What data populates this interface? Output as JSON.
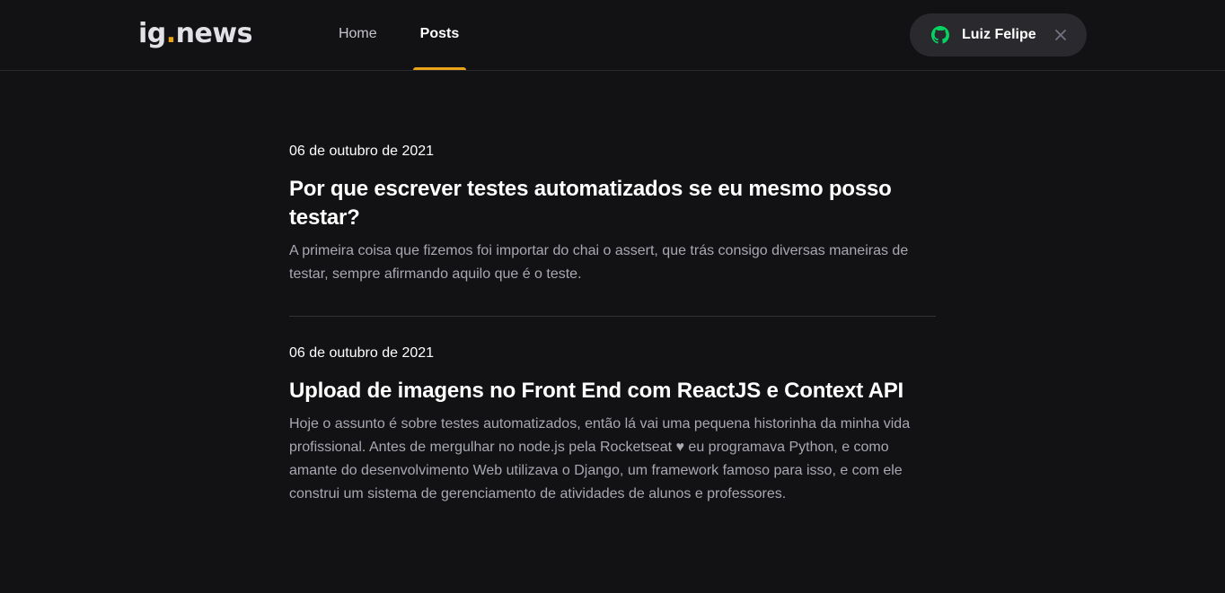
{
  "header": {
    "logo_main": "ig",
    "logo_dot": ".",
    "logo_rest": "news",
    "nav": [
      {
        "label": "Home",
        "active": false
      },
      {
        "label": "Posts",
        "active": true
      }
    ],
    "user": {
      "name": "Luiz Felipe",
      "icon": "github-icon",
      "close_icon": "close-icon"
    }
  },
  "posts": [
    {
      "date": "06 de outubro de 2021",
      "title": "Por que escrever testes automatizados se eu mesmo posso testar?",
      "excerpt": "A primeira coisa que fizemos foi importar do chai o assert, que trás consigo diversas maneiras de testar, sempre afirmando aquilo que é o teste."
    },
    {
      "date": "06 de outubro de 2021",
      "title": "Upload de imagens no Front End com ReactJS e Context API",
      "excerpt": "Hoje o assunto é sobre testes automatizados, então lá vai uma pequena historinha da minha vida profissional. Antes de mergulhar no node.js pela Rocketseat ♥ eu programava Python, e como amante do desenvolvimento Web utilizava o Django, um framework famoso para isso, e com ele construi um sistema de gerenciamento de atividades de alunos e professores."
    }
  ],
  "colors": {
    "background": "#121214",
    "accent": "#eba417",
    "github_green": "#04d361",
    "text_muted": "#a8a8b3"
  }
}
